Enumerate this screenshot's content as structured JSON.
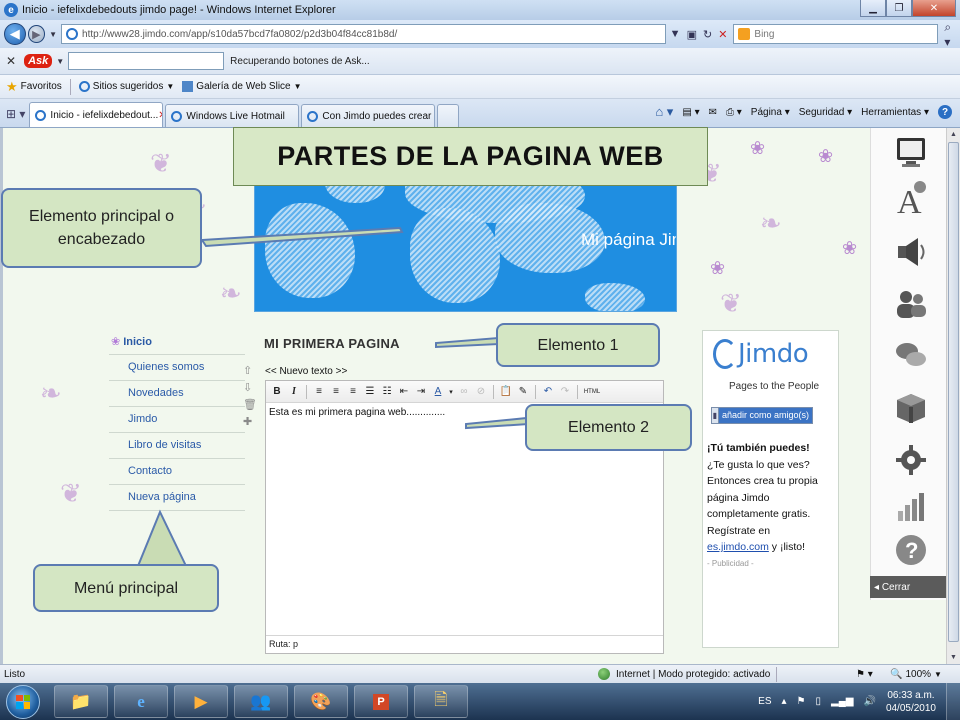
{
  "browser": {
    "window_title": "Inicio - iefelixdebedouts jimdo page! - Windows Internet Explorer",
    "url": "http://www28.jimdo.com/app/s10da57bcd7fa0802/p2d3b04f84cc81b8d/",
    "search_engine": "Bing",
    "ask_status": "Recuperando botones de Ask...",
    "ask_logo": "Ask",
    "favorites": {
      "label": "Favoritos",
      "suggested_sites": "Sitios sugeridos",
      "web_slice_gallery": "Galería de Web Slice"
    },
    "tabs": [
      {
        "label": "Inicio - iefelixdebedout...",
        "active": true
      },
      {
        "label": "Windows Live Hotmail",
        "active": false
      },
      {
        "label": "Con Jimdo puedes crear ...",
        "active": false
      }
    ],
    "command_bar": {
      "page": "Página",
      "security": "Seguridad",
      "tools": "Herramientas"
    }
  },
  "annotations": {
    "title": "PARTES DE LA PAGINA WEB",
    "header_callout": "Elemento principal o encabezado",
    "element1": "Elemento 1",
    "element2": "Elemento 2",
    "menu_callout": "Menú principal"
  },
  "site": {
    "header_text": "Mi página Jin",
    "menu": [
      "Inicio",
      "Quienes somos",
      "Novedades",
      "Jimdo",
      "Libro de visitas",
      "Contacto",
      "Nueva página"
    ],
    "content_title": "MI PRIMERA PAGINA",
    "editor_label": "<< Nuevo texto >>",
    "editor_text": "Esta es mi primera pagina web..............",
    "editor_path": "Ruta: p",
    "toolbar_html": "HTML"
  },
  "jimdo_box": {
    "logo": "Jimdo",
    "tagline": "Pages to the People",
    "friend_button": "añadir como amigo(s)",
    "promo_heading": "¡Tú también puedes!",
    "promo_lines": [
      "¿Te gusta lo que ves?",
      "Entonces crea tu propia",
      "página Jimdo",
      "completamente gratis.",
      "Regístrate en"
    ],
    "promo_link": "es.jimdo.com",
    "promo_end": " y ¡listo!",
    "ad_label": "- Publicidad -"
  },
  "side_panel": {
    "close_label": "Cerrar",
    "icons": [
      "monitor-icon",
      "font-icon",
      "speaker-icon",
      "users-icon",
      "chat-icon",
      "box-icon",
      "gear-icon",
      "stats-icon",
      "help-icon"
    ]
  },
  "statusbar": {
    "left": "Listo",
    "zone": "Internet | Modo protegido: activado",
    "zoom": "100%"
  },
  "taskbar": {
    "language": "ES",
    "time": "06:33 a.m.",
    "date": "04/05/2010"
  }
}
